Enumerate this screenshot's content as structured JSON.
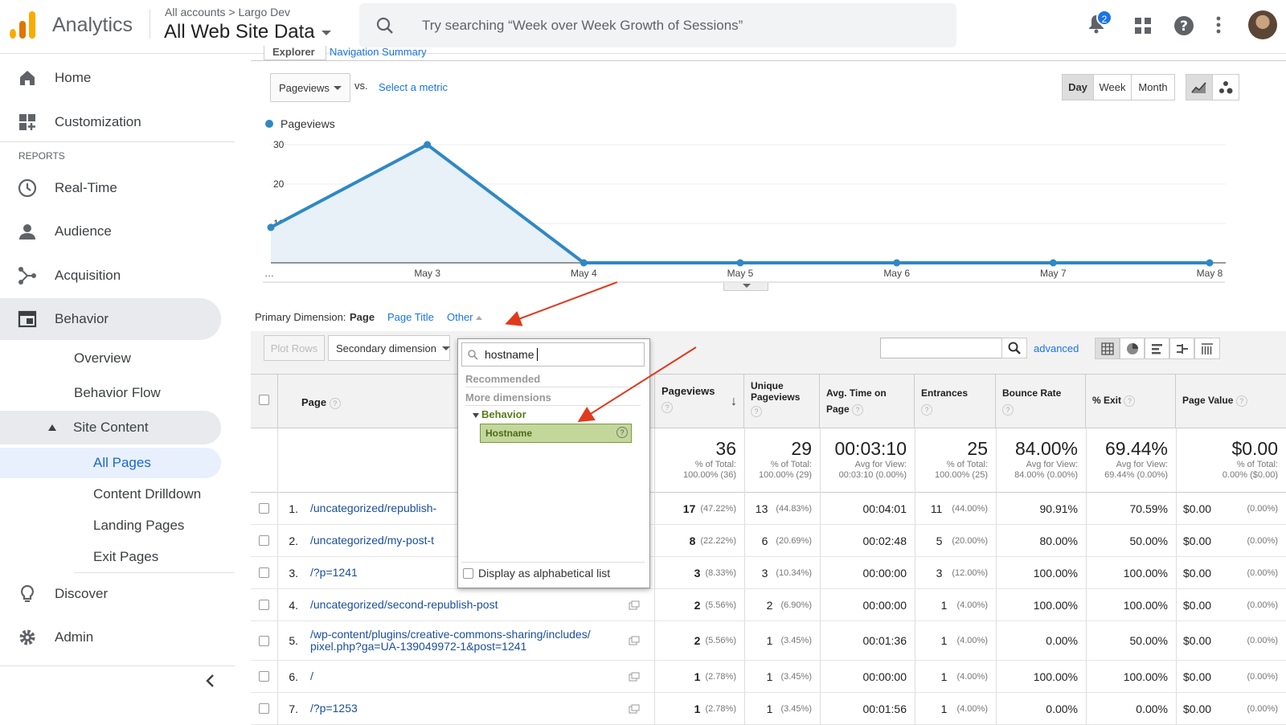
{
  "header": {
    "app_name": "Analytics",
    "breadcrumb": "All accounts > Largo Dev",
    "view_name": "All Web Site Data",
    "search_placeholder": "Try searching “Week over Week Growth of Sessions”",
    "notification_count": "2"
  },
  "sidebar": {
    "home": "Home",
    "customization": "Customization",
    "reports_heading": "REPORTS",
    "realtime": "Real-Time",
    "audience": "Audience",
    "acquisition": "Acquisition",
    "behavior": "Behavior",
    "overview": "Overview",
    "behavior_flow": "Behavior Flow",
    "site_content": "Site Content",
    "all_pages": "All Pages",
    "content_drilldown": "Content Drilldown",
    "landing_pages": "Landing Pages",
    "exit_pages": "Exit Pages",
    "discover": "Discover",
    "admin": "Admin"
  },
  "tabs": {
    "explorer": "Explorer",
    "navigation_summary": "Navigation Summary"
  },
  "controls": {
    "metric_select": "Pageviews",
    "vs": "vs.",
    "select_metric": "Select a metric",
    "day": "Day",
    "week": "Week",
    "month": "Month"
  },
  "chart_data": {
    "type": "area",
    "series": [
      {
        "name": "Pageviews",
        "values": [
          9,
          30,
          0,
          0,
          0,
          0,
          0
        ]
      }
    ],
    "categories": [
      "…",
      "May 3",
      "May 4",
      "May 5",
      "May 6",
      "May 7",
      "May 8"
    ],
    "yticks": [
      "30",
      "20",
      "10"
    ],
    "ylim": [
      0,
      30
    ],
    "color": "#2f88c4"
  },
  "primary_dimension": {
    "label": "Primary Dimension:",
    "page": "Page",
    "page_title": "Page Title",
    "other": "Other"
  },
  "toolbar": {
    "plot_rows": "Plot Rows",
    "secondary_dimension": "Secondary dimension",
    "advanced": "advanced"
  },
  "dropdown": {
    "search_value": "hostname",
    "recommended": "Recommended",
    "more_dimensions": "More dimensions",
    "behavior_group": "Behavior",
    "hostname": "Hostname",
    "alphabetical": "Display as alphabetical list"
  },
  "table": {
    "columns": {
      "page": "Page",
      "pageviews": "Pageviews",
      "unique_pageviews": "Unique Pageviews",
      "avg_time": "Avg. Time on Page",
      "entrances": "Entrances",
      "bounce_rate": "Bounce Rate",
      "exit": "% Exit",
      "page_value": "Page Value"
    },
    "totals": {
      "pageviews": "36",
      "pageviews_sub": "% of Total: 100.00% (36)",
      "unique": "29",
      "unique_sub": "% of Total: 100.00% (29)",
      "avg_time": "00:03:10",
      "avg_time_sub": "Avg for View: 00:03:10 (0.00%)",
      "entrances": "25",
      "entrances_sub": "% of Total: 100.00% (25)",
      "bounce": "84.00%",
      "bounce_sub": "Avg for View: 84.00% (0.00%)",
      "exit": "69.44%",
      "exit_sub": "Avg for View: 69.44% (0.00%)",
      "value": "$0.00",
      "value_sub": "% of Total: 0.00% ($0.00)"
    },
    "rows": [
      {
        "n": "1.",
        "page": "/uncategorized/republish-",
        "pv": "17",
        "pvp": "(47.22%)",
        "u": "13",
        "up": "(44.83%)",
        "t": "00:04:01",
        "e": "11",
        "ep": "(44.00%)",
        "b": "90.91%",
        "x": "70.59%",
        "v": "$0.00",
        "vp": "(0.00%)"
      },
      {
        "n": "2.",
        "page": "/uncategorized/my-post-t",
        "pv": "8",
        "pvp": "(22.22%)",
        "u": "6",
        "up": "(20.69%)",
        "t": "00:02:48",
        "e": "5",
        "ep": "(20.00%)",
        "b": "80.00%",
        "x": "50.00%",
        "v": "$0.00",
        "vp": "(0.00%)"
      },
      {
        "n": "3.",
        "page": "/?p=1241",
        "pv": "3",
        "pvp": "(8.33%)",
        "u": "3",
        "up": "(10.34%)",
        "t": "00:00:00",
        "e": "3",
        "ep": "(12.00%)",
        "b": "100.00%",
        "x": "100.00%",
        "v": "$0.00",
        "vp": "(0.00%)"
      },
      {
        "n": "4.",
        "page": "/uncategorized/second-republish-post",
        "pv": "2",
        "pvp": "(5.56%)",
        "u": "2",
        "up": "(6.90%)",
        "t": "00:00:00",
        "e": "1",
        "ep": "(4.00%)",
        "b": "100.00%",
        "x": "100.00%",
        "v": "$0.00",
        "vp": "(0.00%)"
      },
      {
        "n": "5.",
        "page": "/wp-content/plugins/creative-commons-sharing/includes/",
        "page2": "pixel.php?ga=UA-139049972-1&post=1241",
        "pv": "2",
        "pvp": "(5.56%)",
        "u": "1",
        "up": "(3.45%)",
        "t": "00:01:36",
        "e": "1",
        "ep": "(4.00%)",
        "b": "0.00%",
        "x": "50.00%",
        "v": "$0.00",
        "vp": "(0.00%)"
      },
      {
        "n": "6.",
        "page": "/",
        "pv": "1",
        "pvp": "(2.78%)",
        "u": "1",
        "up": "(3.45%)",
        "t": "00:00:00",
        "e": "1",
        "ep": "(4.00%)",
        "b": "100.00%",
        "x": "100.00%",
        "v": "$0.00",
        "vp": "(0.00%)"
      },
      {
        "n": "7.",
        "page": "/?p=1253",
        "pv": "1",
        "pvp": "(2.78%)",
        "u": "1",
        "up": "(3.45%)",
        "t": "00:01:56",
        "e": "1",
        "ep": "(4.00%)",
        "b": "0.00%",
        "x": "0.00%",
        "v": "$0.00",
        "vp": "(0.00%)"
      }
    ]
  }
}
